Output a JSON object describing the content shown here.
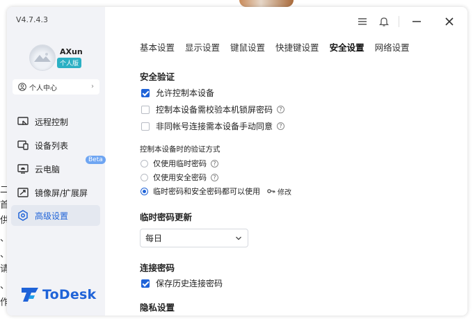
{
  "background": {
    "text_fragments": [
      "二",
      "首",
      "供",
      "、",
      "、",
      "请",
      "、",
      "作"
    ]
  },
  "sidebar": {
    "version": "V4.7.4.3",
    "username": "AXun",
    "plan_badge": "个人版",
    "personal_center": "个人中心",
    "items": [
      {
        "label": "远程控制",
        "icon": "remote-control-icon"
      },
      {
        "label": "设备列表",
        "icon": "device-list-icon"
      },
      {
        "label": "云电脑",
        "icon": "cloud-pc-icon",
        "badge": "Beta"
      },
      {
        "label": "镜像屏/扩展屏",
        "icon": "mirror-screen-icon"
      },
      {
        "label": "高级设置",
        "icon": "advanced-settings-icon",
        "active": true
      }
    ],
    "logo_text": "ToDesk"
  },
  "titlebar": {
    "icons": [
      "menu-icon",
      "bell-icon",
      "minimize-icon",
      "close-icon"
    ]
  },
  "tabs": [
    {
      "label": "基本设置"
    },
    {
      "label": "显示设置"
    },
    {
      "label": "键鼠设置"
    },
    {
      "label": "快捷键设置"
    },
    {
      "label": "安全设置",
      "active": true
    },
    {
      "label": "网络设置"
    }
  ],
  "security": {
    "title": "安全验证",
    "options": [
      {
        "label": "允许控制本设备",
        "checked": true
      },
      {
        "label": "控制本设备需校验本机锁屏密码",
        "checked": false,
        "help": true
      },
      {
        "label": "非同帐号连接需本设备手动同意",
        "checked": false,
        "help": true
      }
    ],
    "auth_method_title": "控制本设备时的验证方式",
    "auth_methods": [
      {
        "label": "仅使用临时密码",
        "selected": false
      },
      {
        "label": "仅使用安全密码",
        "selected": false
      },
      {
        "label": "临时密码和安全密码都可以使用",
        "selected": true
      }
    ],
    "modify_label": "修改"
  },
  "temp_password": {
    "title": "临时密码更新",
    "selected": "每日"
  },
  "connection_password": {
    "title": "连接密码",
    "option_label": "保存历史连接密码",
    "checked": true
  },
  "privacy": {
    "title": "隐私设置"
  },
  "colors": {
    "accent": "#1f63d8",
    "sidebar_bg": "#f2f3f7",
    "badge": "#2bb0c4"
  }
}
